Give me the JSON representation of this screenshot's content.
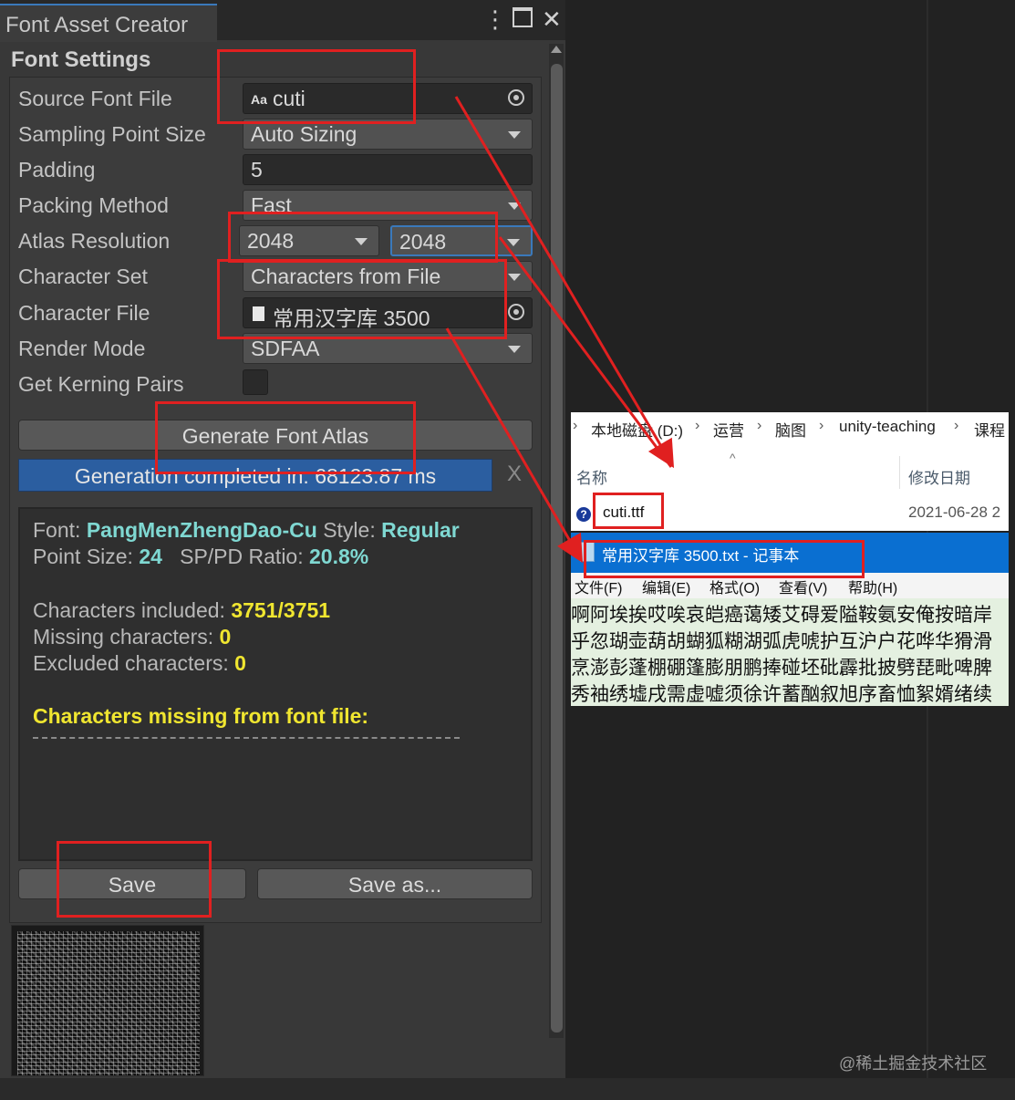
{
  "window": {
    "tab_title": "Font Asset Creator",
    "menu_icon": "kebab-menu-icon",
    "maximize_icon": "maximize-icon",
    "close_icon": "close-icon"
  },
  "font_settings": {
    "section_title": "Font Settings",
    "fields": [
      {
        "label": "Source Font File",
        "value": "cuti"
      },
      {
        "label": "Sampling Point Size",
        "value": "Auto Sizing"
      },
      {
        "label": "Padding",
        "value": "5"
      },
      {
        "label": "Packing Method",
        "value": "Fast"
      },
      {
        "label": "Atlas Resolution",
        "width": "2048",
        "height": "2048"
      },
      {
        "label": "Character Set",
        "value": "Characters from File"
      },
      {
        "label": "Character File",
        "value": "常用汉字库 3500"
      },
      {
        "label": "Render Mode",
        "value": "SDFAA"
      },
      {
        "label": "Get Kerning Pairs",
        "checked": false
      }
    ],
    "generate_button": "Generate Font Atlas",
    "progress_text": "Generation completed in: 68123.87 ms",
    "progress_close": "X"
  },
  "info": {
    "font_label": "Font:",
    "font_value": "PangMenZhengDao-Cu",
    "style_label": "Style:",
    "style_value": "Regular",
    "point_size_label": "Point Size:",
    "point_size_value": "24",
    "ratio_label": "SP/PD Ratio:",
    "ratio_value": "20.8%",
    "included_label": "Characters included:",
    "included_value": "3751/3751",
    "missing_label": "Missing characters:",
    "missing_value": "0",
    "excluded_label": "Excluded characters:",
    "excluded_value": "0",
    "missing_title": "Characters missing from font file:"
  },
  "actions": {
    "save": "Save",
    "save_as": "Save as..."
  },
  "explorer": {
    "breadcrumb": [
      "本地磁盘 (D:)",
      "运营",
      "脑图",
      "unity-teaching",
      "课程"
    ],
    "col_name": "名称",
    "col_date": "修改日期",
    "file_name": "cuti.ttf",
    "file_date": "2021-06-28 2"
  },
  "notepad": {
    "title": "常用汉字库 3500.txt - 记事本",
    "menu": [
      "文件(F)",
      "编辑(E)",
      "格式(O)",
      "查看(V)",
      "帮助(H)"
    ],
    "lines": [
      "啊阿埃挨哎唉哀皑癌蔼矮艾碍爱隘鞍氨安俺按暗岸",
      "乎忽瑚壶葫胡蝴狐糊湖弧虎唬护互沪户花哗华猾滑",
      "烹澎彭蓬棚硼篷膨朋鹏捧碰坯砒霹批披劈琵毗啤脾",
      "秀袖绣墟戌需虚嘘须徐许蓄酗叙旭序畜恤絮婿绪续"
    ]
  },
  "watermark": "@稀土掘金技术社区",
  "colors": {
    "annotation": "#e02020",
    "progress": "#2b5ea0",
    "value_cyan": "#7fd8d2",
    "value_yellow": "#f0e630",
    "notepad_title": "#0a6fd1"
  }
}
